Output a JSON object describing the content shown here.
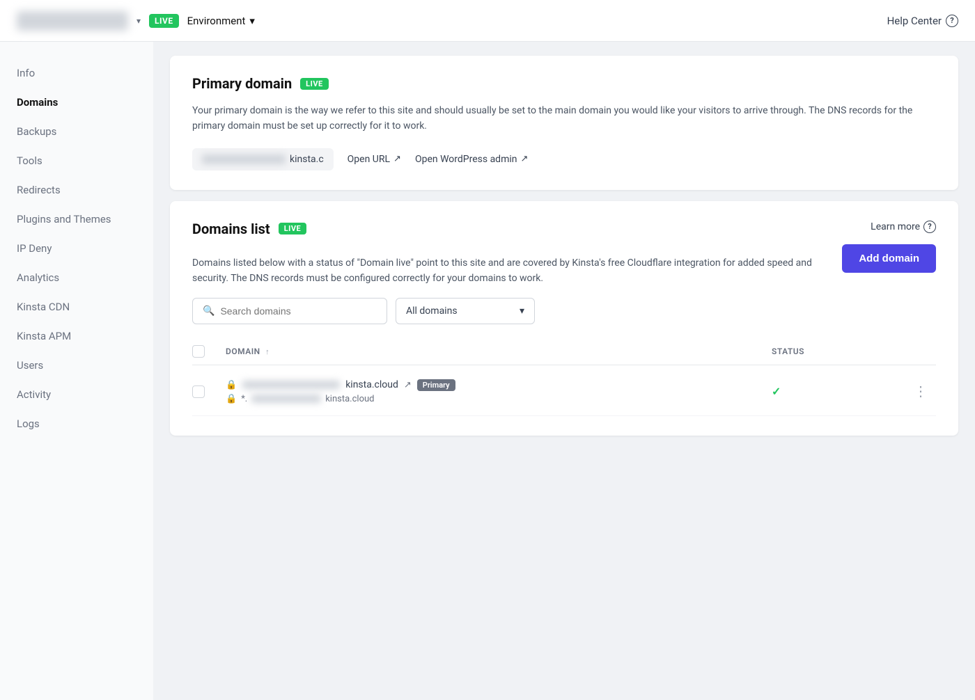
{
  "topnav": {
    "live_label": "LIVE",
    "environment_label": "Environment",
    "help_label": "Help Center",
    "chevron": "▾",
    "question_mark": "?"
  },
  "sidebar": {
    "items": [
      {
        "id": "info",
        "label": "Info",
        "active": false
      },
      {
        "id": "domains",
        "label": "Domains",
        "active": true
      },
      {
        "id": "backups",
        "label": "Backups",
        "active": false
      },
      {
        "id": "tools",
        "label": "Tools",
        "active": false
      },
      {
        "id": "redirects",
        "label": "Redirects",
        "active": false
      },
      {
        "id": "plugins-themes",
        "label": "Plugins and Themes",
        "active": false
      },
      {
        "id": "ip-deny",
        "label": "IP Deny",
        "active": false
      },
      {
        "id": "analytics",
        "label": "Analytics",
        "active": false
      },
      {
        "id": "kinsta-cdn",
        "label": "Kinsta CDN",
        "active": false
      },
      {
        "id": "kinsta-apm",
        "label": "Kinsta APM",
        "active": false
      },
      {
        "id": "users",
        "label": "Users",
        "active": false
      },
      {
        "id": "activity",
        "label": "Activity",
        "active": false
      },
      {
        "id": "logs",
        "label": "Logs",
        "active": false
      }
    ]
  },
  "primary_domain": {
    "title": "Primary domain",
    "badge": "LIVE",
    "description": "Your primary domain is the way we refer to this site and should usually be set to the main domain you would like your visitors to arrive through. The DNS records for the primary domain must be set up correctly for it to work.",
    "domain_suffix": "kinsta.c",
    "open_url_label": "Open URL",
    "open_wp_admin_label": "Open WordPress admin"
  },
  "domains_list": {
    "title": "Domains list",
    "badge": "LIVE",
    "learn_more_label": "Learn more",
    "description": "Domains listed below with a status of \"Domain live\" point to this site and are covered by Kinsta's free Cloudflare integration for added speed and security. The DNS records must be configured correctly for your domains to work.",
    "add_domain_label": "Add domain",
    "search_placeholder": "Search domains",
    "filter_label": "All domains",
    "filter_chevron": "▾",
    "table": {
      "col_domain": "DOMAIN",
      "col_sort_icon": "↑",
      "col_status": "STATUS",
      "rows": [
        {
          "domain_suffix": "kinsta.cloud",
          "is_primary": true,
          "primary_label": "Primary",
          "has_wildcard": true,
          "wildcard_suffix": "kinsta.cloud",
          "status_check": "✓"
        }
      ]
    }
  }
}
